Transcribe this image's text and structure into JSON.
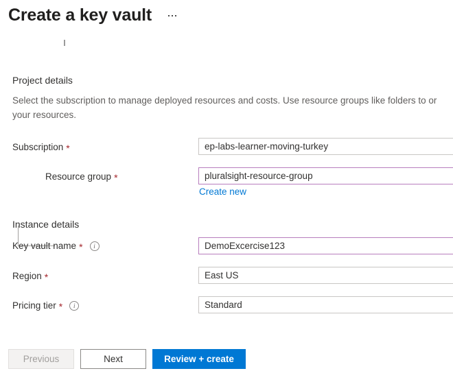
{
  "header": {
    "title": "Create a key vault",
    "more_menu": "more-options"
  },
  "sections": {
    "project": {
      "title": "Project details",
      "description_line1": "Select the subscription to manage deployed resources and costs. Use resource groups like folders to or",
      "description_line2": "your resources."
    },
    "instance": {
      "title": "Instance details"
    }
  },
  "fields": {
    "subscription": {
      "label": "Subscription",
      "required": "*",
      "value": "ep-labs-learner-moving-turkey"
    },
    "resource_group": {
      "label": "Resource group",
      "required": "*",
      "value": "pluralsight-resource-group",
      "create_new_link": "Create new"
    },
    "key_vault_name": {
      "label": "Key vault name",
      "required": "*",
      "value": "DemoExcercise123",
      "info": "i"
    },
    "region": {
      "label": "Region",
      "required": "*",
      "value": "East US"
    },
    "pricing_tier": {
      "label": "Pricing tier",
      "required": "*",
      "value": "Standard",
      "info": "i"
    }
  },
  "footer": {
    "previous": "Previous",
    "next": "Next",
    "review_create": "Review + create"
  },
  "colors": {
    "accent": "#0078d4",
    "required": "#a4262c",
    "modified_border": "#b77dbd",
    "default_border": "#c8c6c4"
  }
}
